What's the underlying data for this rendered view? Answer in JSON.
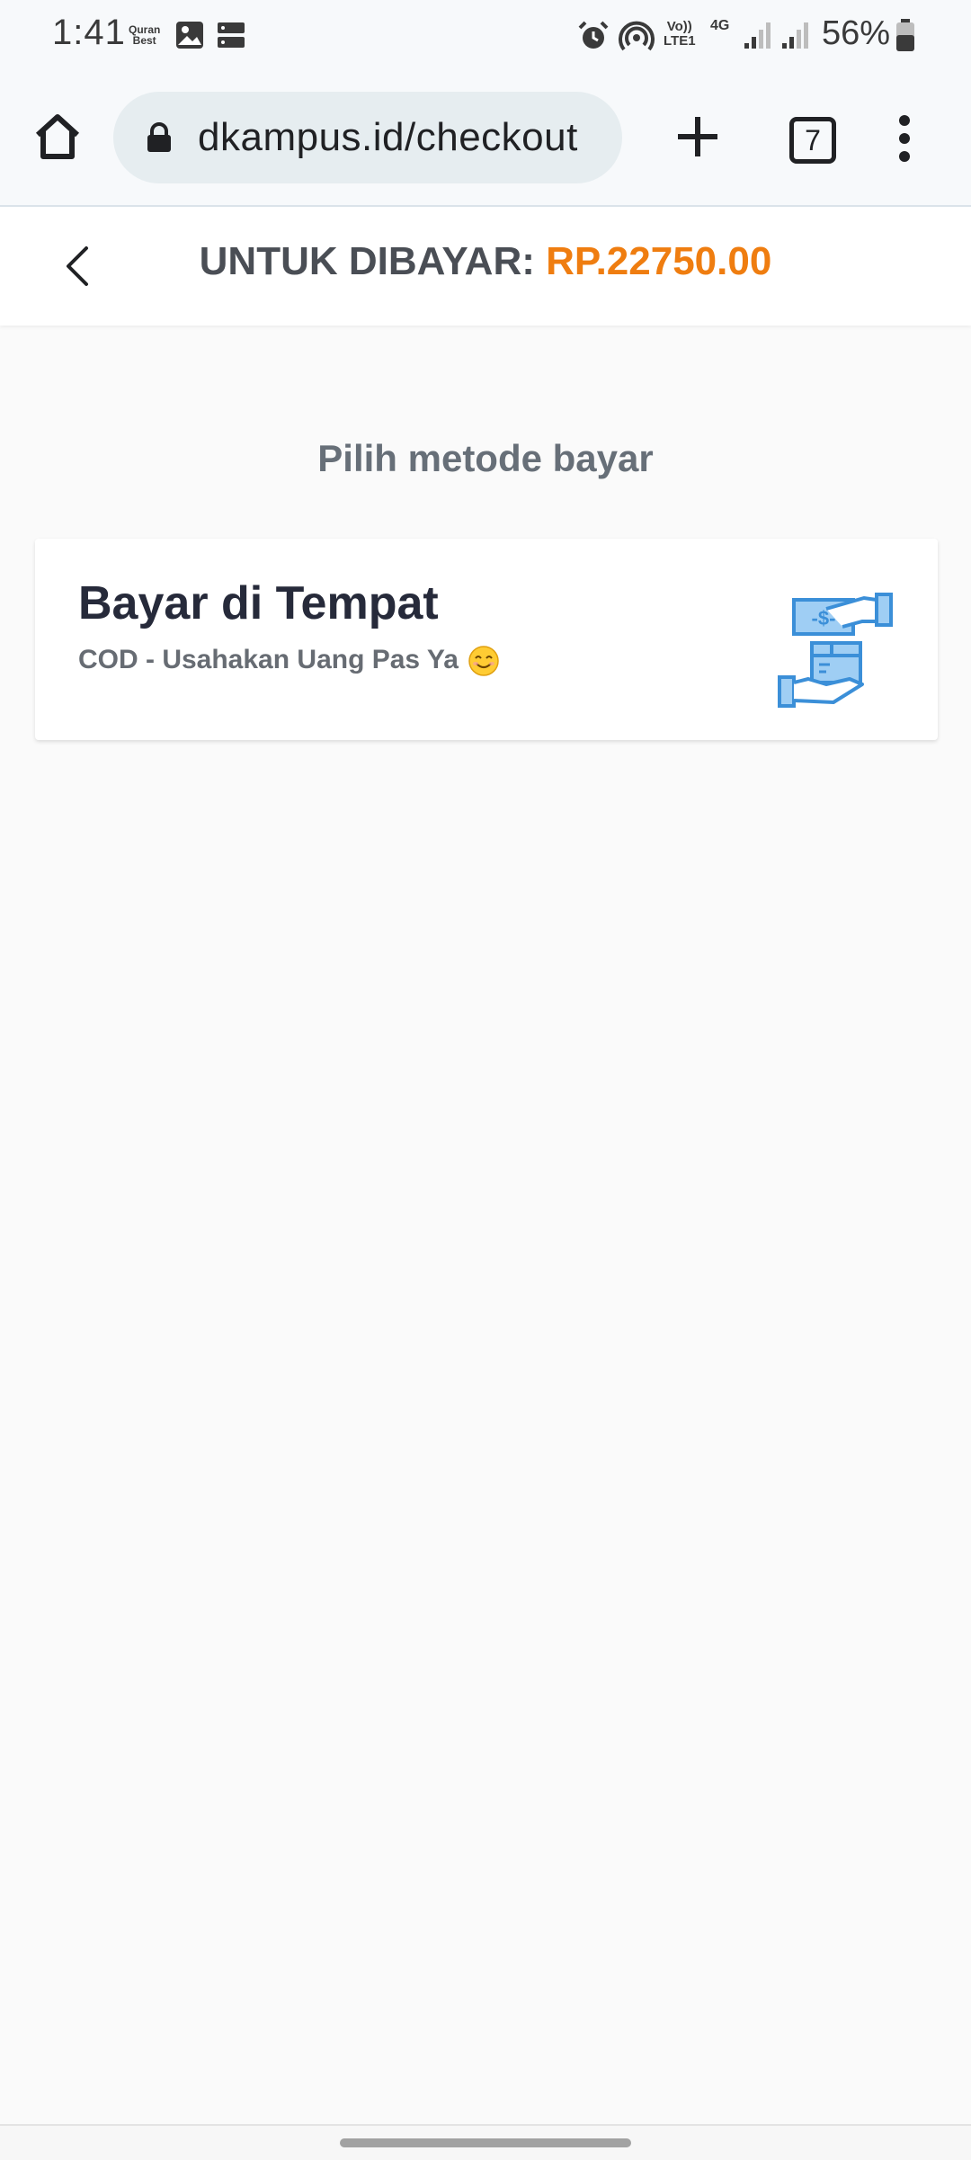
{
  "status_bar": {
    "time": "1:41",
    "app_badge_line1": "Quran",
    "app_badge_line2": "Best",
    "network_label_top": "Vo))",
    "network_label_bottom": "LTE1",
    "network_type": "4G",
    "battery_percent": "56%",
    "icons": [
      "image-icon",
      "storage-icon",
      "alarm-icon",
      "hotspot-icon",
      "signal-icon",
      "signal-icon",
      "battery-icon"
    ]
  },
  "browser": {
    "url": "dkampus.id/checkout",
    "tab_count": "7",
    "icons": [
      "home-icon",
      "lock-icon",
      "plus-icon",
      "more-vert-icon"
    ]
  },
  "header": {
    "label": "UNTUK DIBAYAR:",
    "amount": "RP.22750.00",
    "icon": "back-arrow-icon"
  },
  "main": {
    "section_title": "Pilih metode bayar",
    "payment_methods": [
      {
        "title": "Bayar di Tempat",
        "subtitle": "COD - Usahakan Uang Pas Ya",
        "icon": "cash-on-delivery-icon"
      }
    ]
  },
  "colors": {
    "accent": "#ef7d10",
    "icon_blue": "#3b8fd8",
    "icon_blue_fill": "#9fcef4"
  }
}
